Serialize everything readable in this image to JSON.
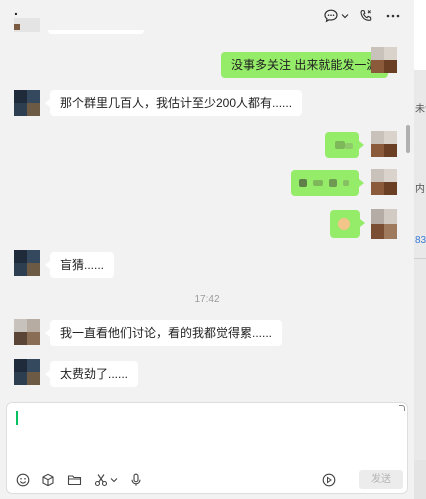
{
  "header": {
    "title": "."
  },
  "messages": [
    {
      "side": "right",
      "text": "没事多关注 出来就能发一波"
    },
    {
      "side": "left",
      "text": "那个群里几百人，我估计至少200人都有......"
    },
    {
      "side": "right",
      "text": "",
      "pixelated": true
    },
    {
      "side": "right",
      "text": "",
      "pixelated": true
    },
    {
      "side": "right",
      "text": "",
      "pixelated": true
    },
    {
      "side": "left",
      "text": "盲猜......"
    },
    {
      "side": "left",
      "text": "我一直看他们讨论，看的我都觉得累......"
    },
    {
      "side": "left",
      "text": "太费劲了......"
    }
  ],
  "timestamp": "17:42",
  "composer": {
    "text": "",
    "send_label": "发送",
    "toolbar_icons": [
      "emoji-icon",
      "cube-icon",
      "folder-icon",
      "scissors-icon",
      "microphone-icon",
      "voice-input-icon"
    ]
  },
  "header_icons": [
    "chat-bubble-icon",
    "chevron-down-icon",
    "phone-icon",
    "more-icon"
  ],
  "colors": {
    "self_bubble": "#95ec69",
    "other_bubble": "#ffffff",
    "background": "#f2f2f2",
    "caret": "#07c160",
    "send_disabled_bg": "#ececec"
  },
  "right_strip": {
    "chars": [
      "未读",
      "内",
      "83"
    ]
  }
}
